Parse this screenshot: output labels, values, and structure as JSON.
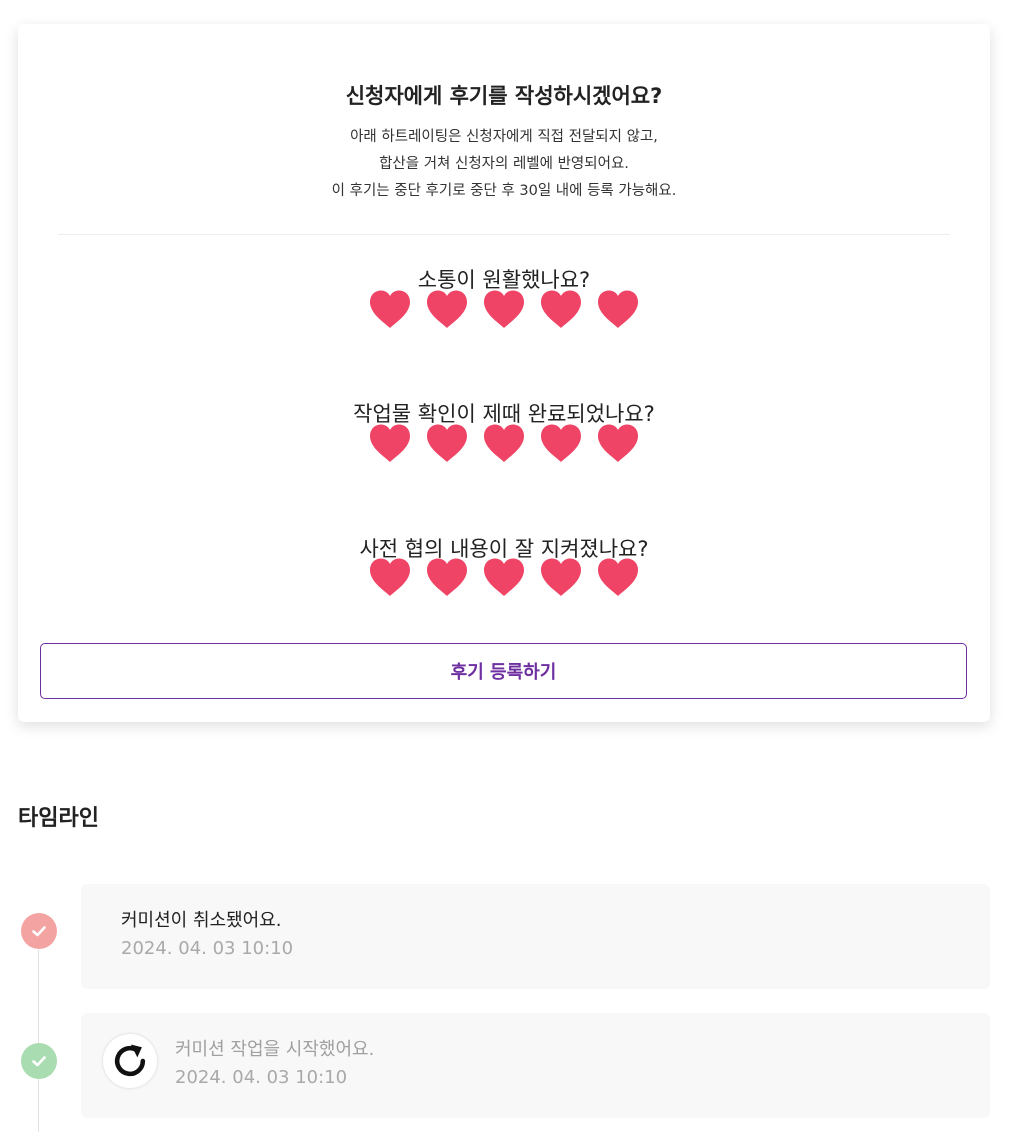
{
  "review": {
    "title": "신청자에게 후기를 작성하시겠어요?",
    "description": [
      "아래 하트레이팅은 신청자에게 직접 전달되지 않고,",
      "합산을 거쳐 신청자의 레벨에 반영되어요.",
      "이 후기는 중단 후기로 중단 후 30일 내에 등록 가능해요."
    ],
    "questions": [
      {
        "label": "소통이 원활했나요?",
        "rating": 5,
        "max": 5
      },
      {
        "label": "작업물 확인이 제때 완료되었나요?",
        "rating": 5,
        "max": 5
      },
      {
        "label": "사전 협의 내용이 잘 지켜졌나요?",
        "rating": 5,
        "max": 5
      }
    ],
    "submit_label": "후기 등록하기",
    "heart_color": "#ef4466",
    "accent_color": "#6e2fa0"
  },
  "timeline": {
    "title": "타임라인",
    "events": [
      {
        "title": "커미션이 취소됐어요.",
        "date": "2024. 04. 03 10:10",
        "status_color": "#f4a3a3",
        "title_color": "#222222",
        "icon": ""
      },
      {
        "title": "커미션 작업을 시작했어요.",
        "date": "2024. 04. 03 10:10",
        "status_color": "#a9dcb0",
        "title_color": "#a0a0a0",
        "icon": "refresh-icon"
      }
    ]
  }
}
